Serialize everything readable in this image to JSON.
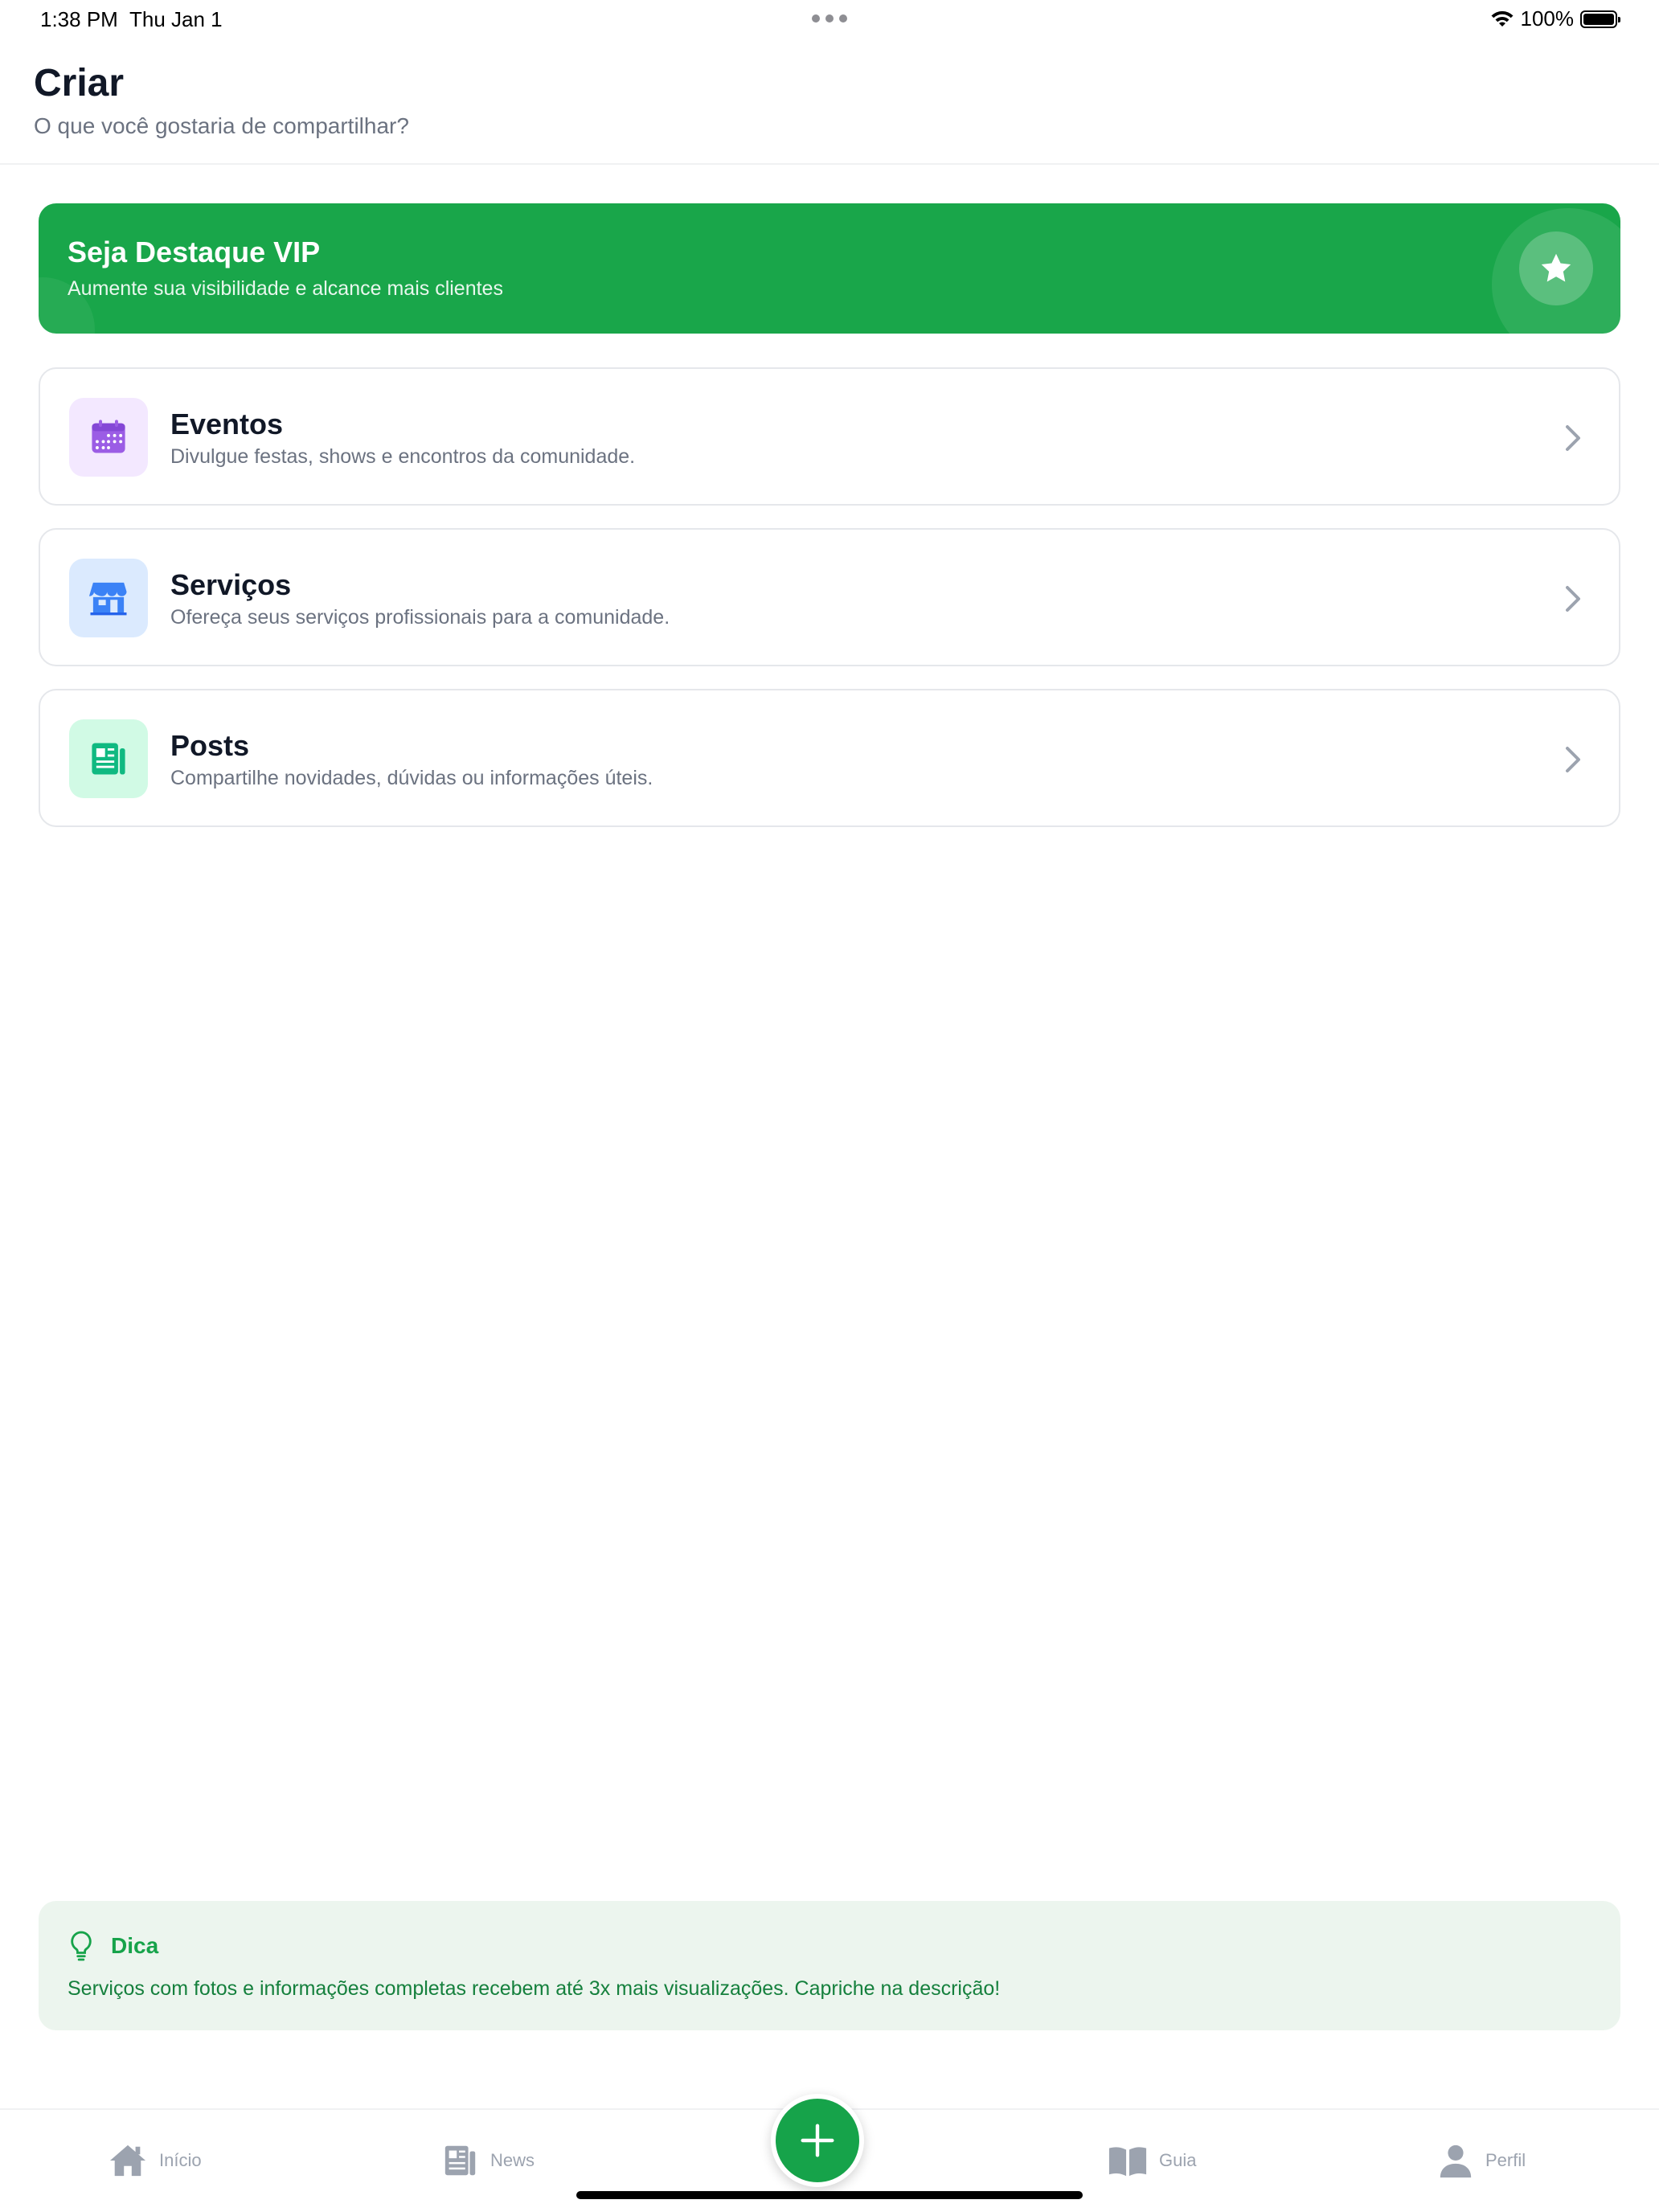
{
  "status_bar": {
    "time": "1:38 PM",
    "date": "Thu Jan 1",
    "battery": "100%",
    "icons": [
      "wifi-icon",
      "battery-icon"
    ]
  },
  "header": {
    "title": "Criar",
    "subtitle": "O que você gostaria de compartilhar?"
  },
  "vip_banner": {
    "title": "Seja Destaque VIP",
    "subtitle": "Aumente sua visibilidade e alcance mais clientes",
    "icon": "star-icon",
    "color": "#19a64a"
  },
  "categories": [
    {
      "title": "Eventos",
      "description": "Divulgue festas, shows e encontros da comunidade.",
      "icon": "calendar-icon",
      "icon_bg": "#f3e8ff",
      "icon_color": "#9b5de5"
    },
    {
      "title": "Serviços",
      "description": "Ofereça seus serviços profissionais para a comunidade.",
      "icon": "store-icon",
      "icon_bg": "#dbeafe",
      "icon_color": "#3b82f6"
    },
    {
      "title": "Posts",
      "description": "Compartilhe novidades, dúvidas ou informações úteis.",
      "icon": "newspaper-icon",
      "icon_bg": "#d1fae5",
      "icon_color": "#10b981"
    }
  ],
  "tip": {
    "title": "Dica",
    "text": "Serviços com fotos e informações completas recebem até 3x mais visualizações. Capriche na descrição!",
    "icon": "lightbulb-icon"
  },
  "tab_bar": {
    "items": [
      {
        "label": "Início",
        "icon": "home-icon"
      },
      {
        "label": "News",
        "icon": "newspaper-icon"
      },
      {
        "label": "Guia",
        "icon": "book-icon"
      },
      {
        "label": "Perfil",
        "icon": "person-icon"
      }
    ],
    "fab_icon": "plus-icon",
    "inactive_color": "#9ca3af",
    "accent": "#16a34a"
  }
}
